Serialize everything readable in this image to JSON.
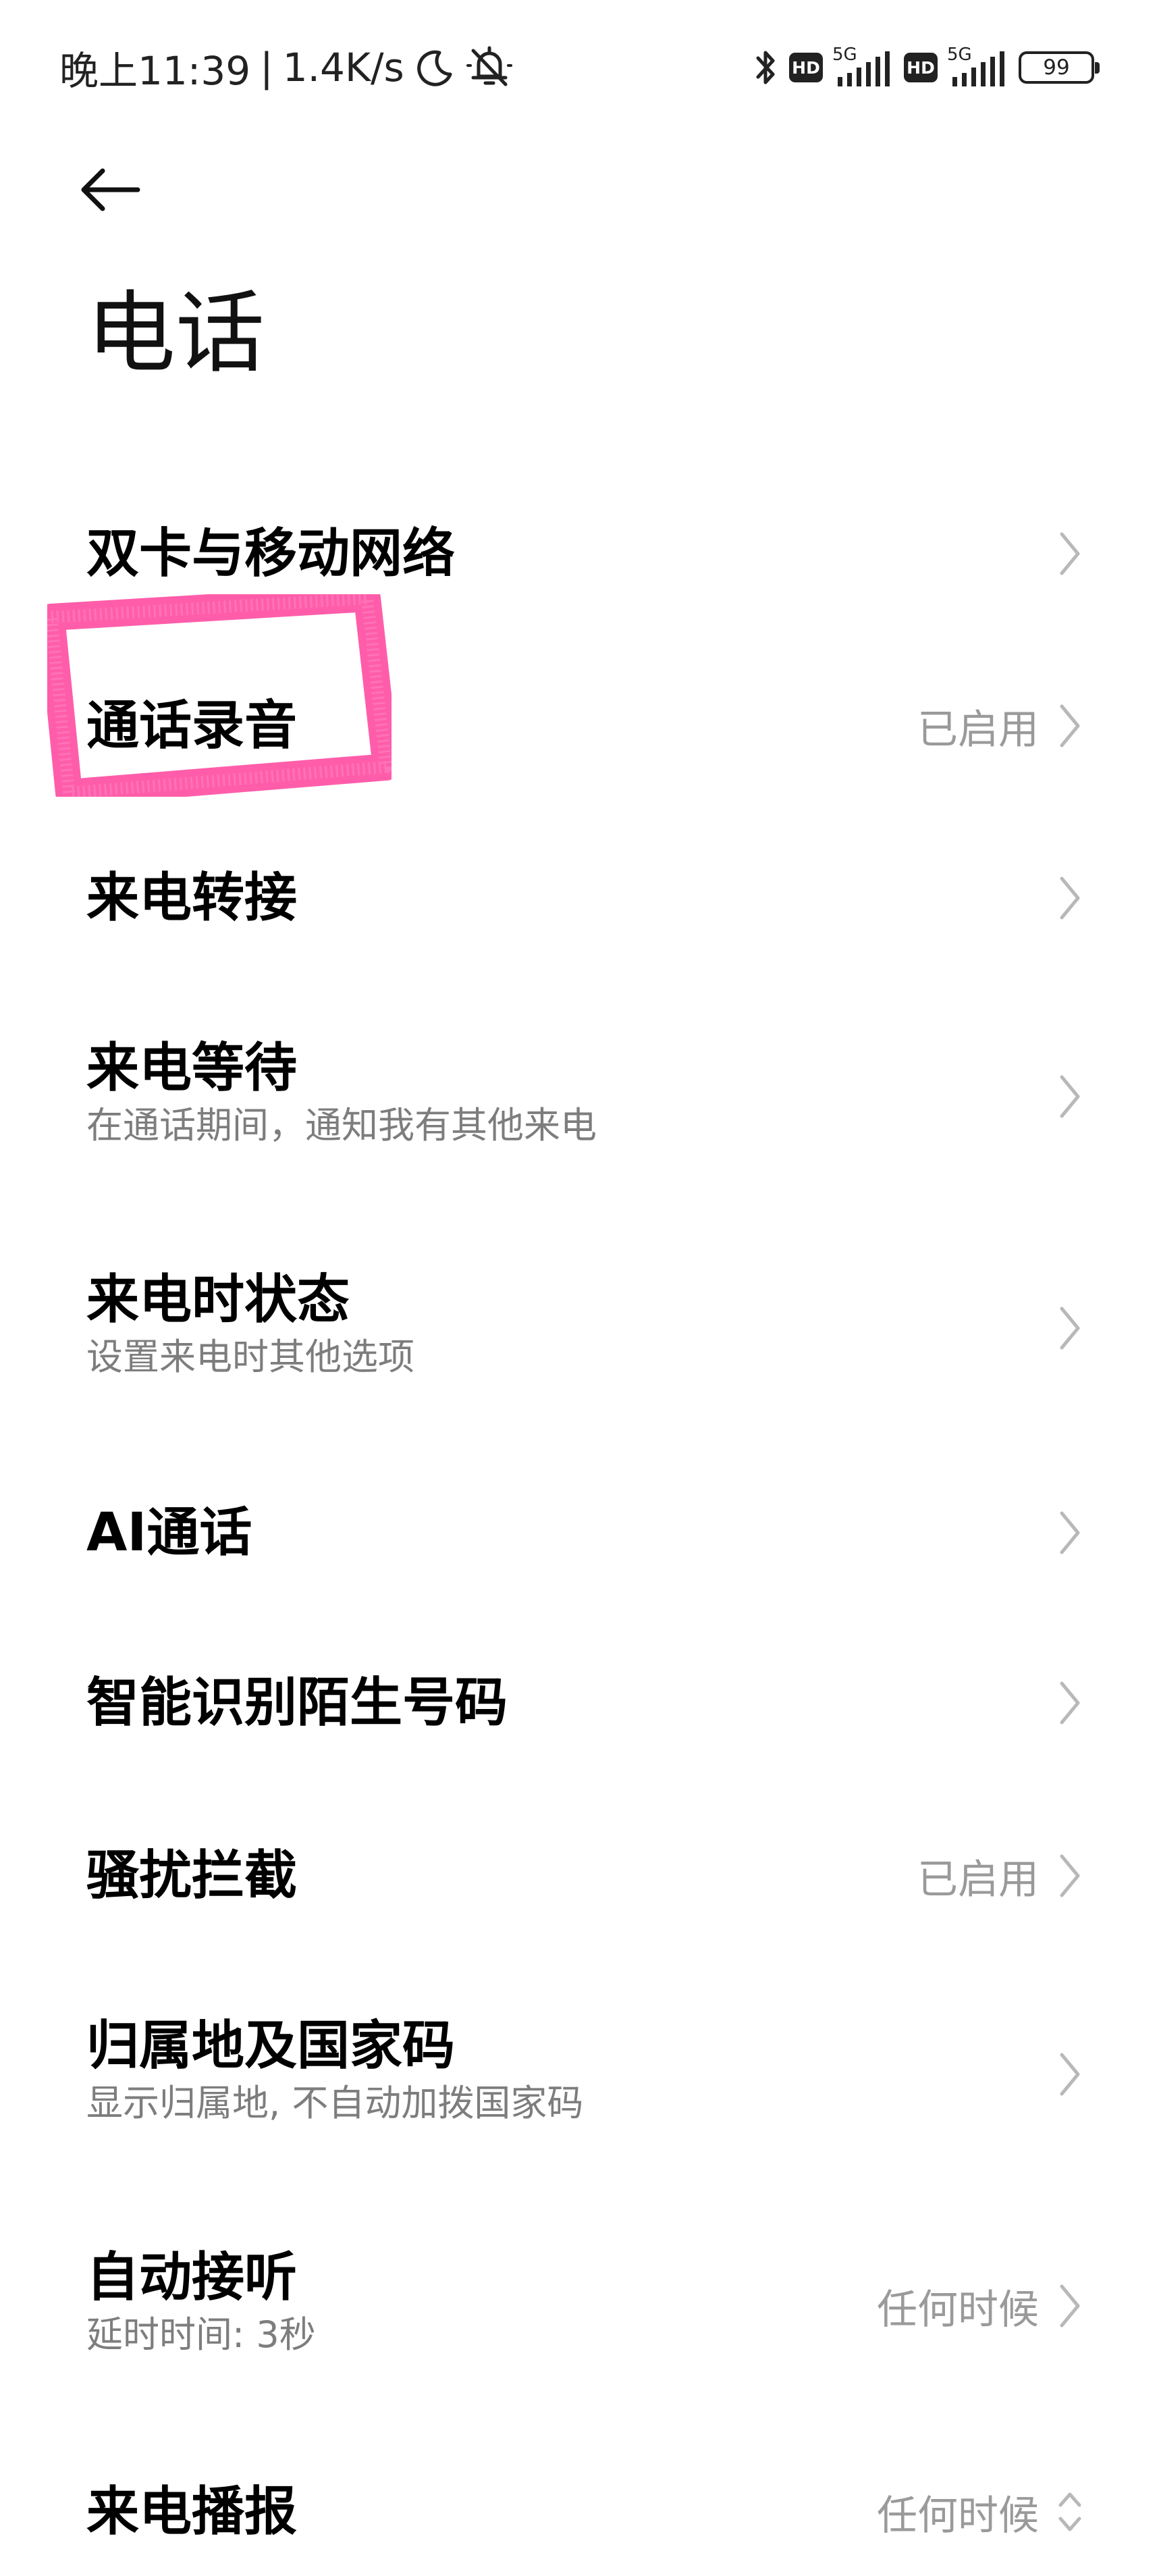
{
  "status_bar": {
    "time": "晚上11:39",
    "separator": "|",
    "speed": "1.4K/s",
    "hd_label_1": "HD",
    "hd_label_2": "HD",
    "network_1": "5G",
    "network_2": "5G",
    "battery": "99",
    "icons": [
      "moon-icon",
      "bell-muted-icon",
      "bluetooth-icon",
      "signal-icon",
      "battery-icon"
    ]
  },
  "header": {
    "title": "电话",
    "back_icon": "arrow-left-icon"
  },
  "settings": [
    {
      "title": "双卡与移动网络",
      "subtitle": "",
      "value": ""
    },
    {
      "title": "通话录音",
      "subtitle": "",
      "value": "已启用"
    },
    {
      "title": "来电转接",
      "subtitle": "",
      "value": ""
    },
    {
      "title": "来电等待",
      "subtitle": "在通话期间，通知我有其他来电",
      "value": ""
    },
    {
      "title": "来电时状态",
      "subtitle": "设置来电时其他选项",
      "value": ""
    },
    {
      "title": "AI通话",
      "subtitle": "",
      "value": ""
    },
    {
      "title": "智能识别陌生号码",
      "subtitle": "",
      "value": ""
    },
    {
      "title": "骚扰拦截",
      "subtitle": "",
      "value": "已启用"
    },
    {
      "title": "归属地及国家码",
      "subtitle": "显示归属地, 不自动加拨国家码",
      "value": ""
    },
    {
      "title": "自动接听",
      "subtitle": "延时时间: 3秒",
      "value": "任何时候"
    },
    {
      "title": "来电播报",
      "subtitle": "",
      "value": "任何时候"
    }
  ],
  "colors": {
    "background": "#ffffff",
    "text_primary": "#000000",
    "text_secondary": "#7d7d7d",
    "text_value": "#9a9a9a",
    "chevron": "#b8b8b8",
    "highlight": "#ff4fa3"
  }
}
